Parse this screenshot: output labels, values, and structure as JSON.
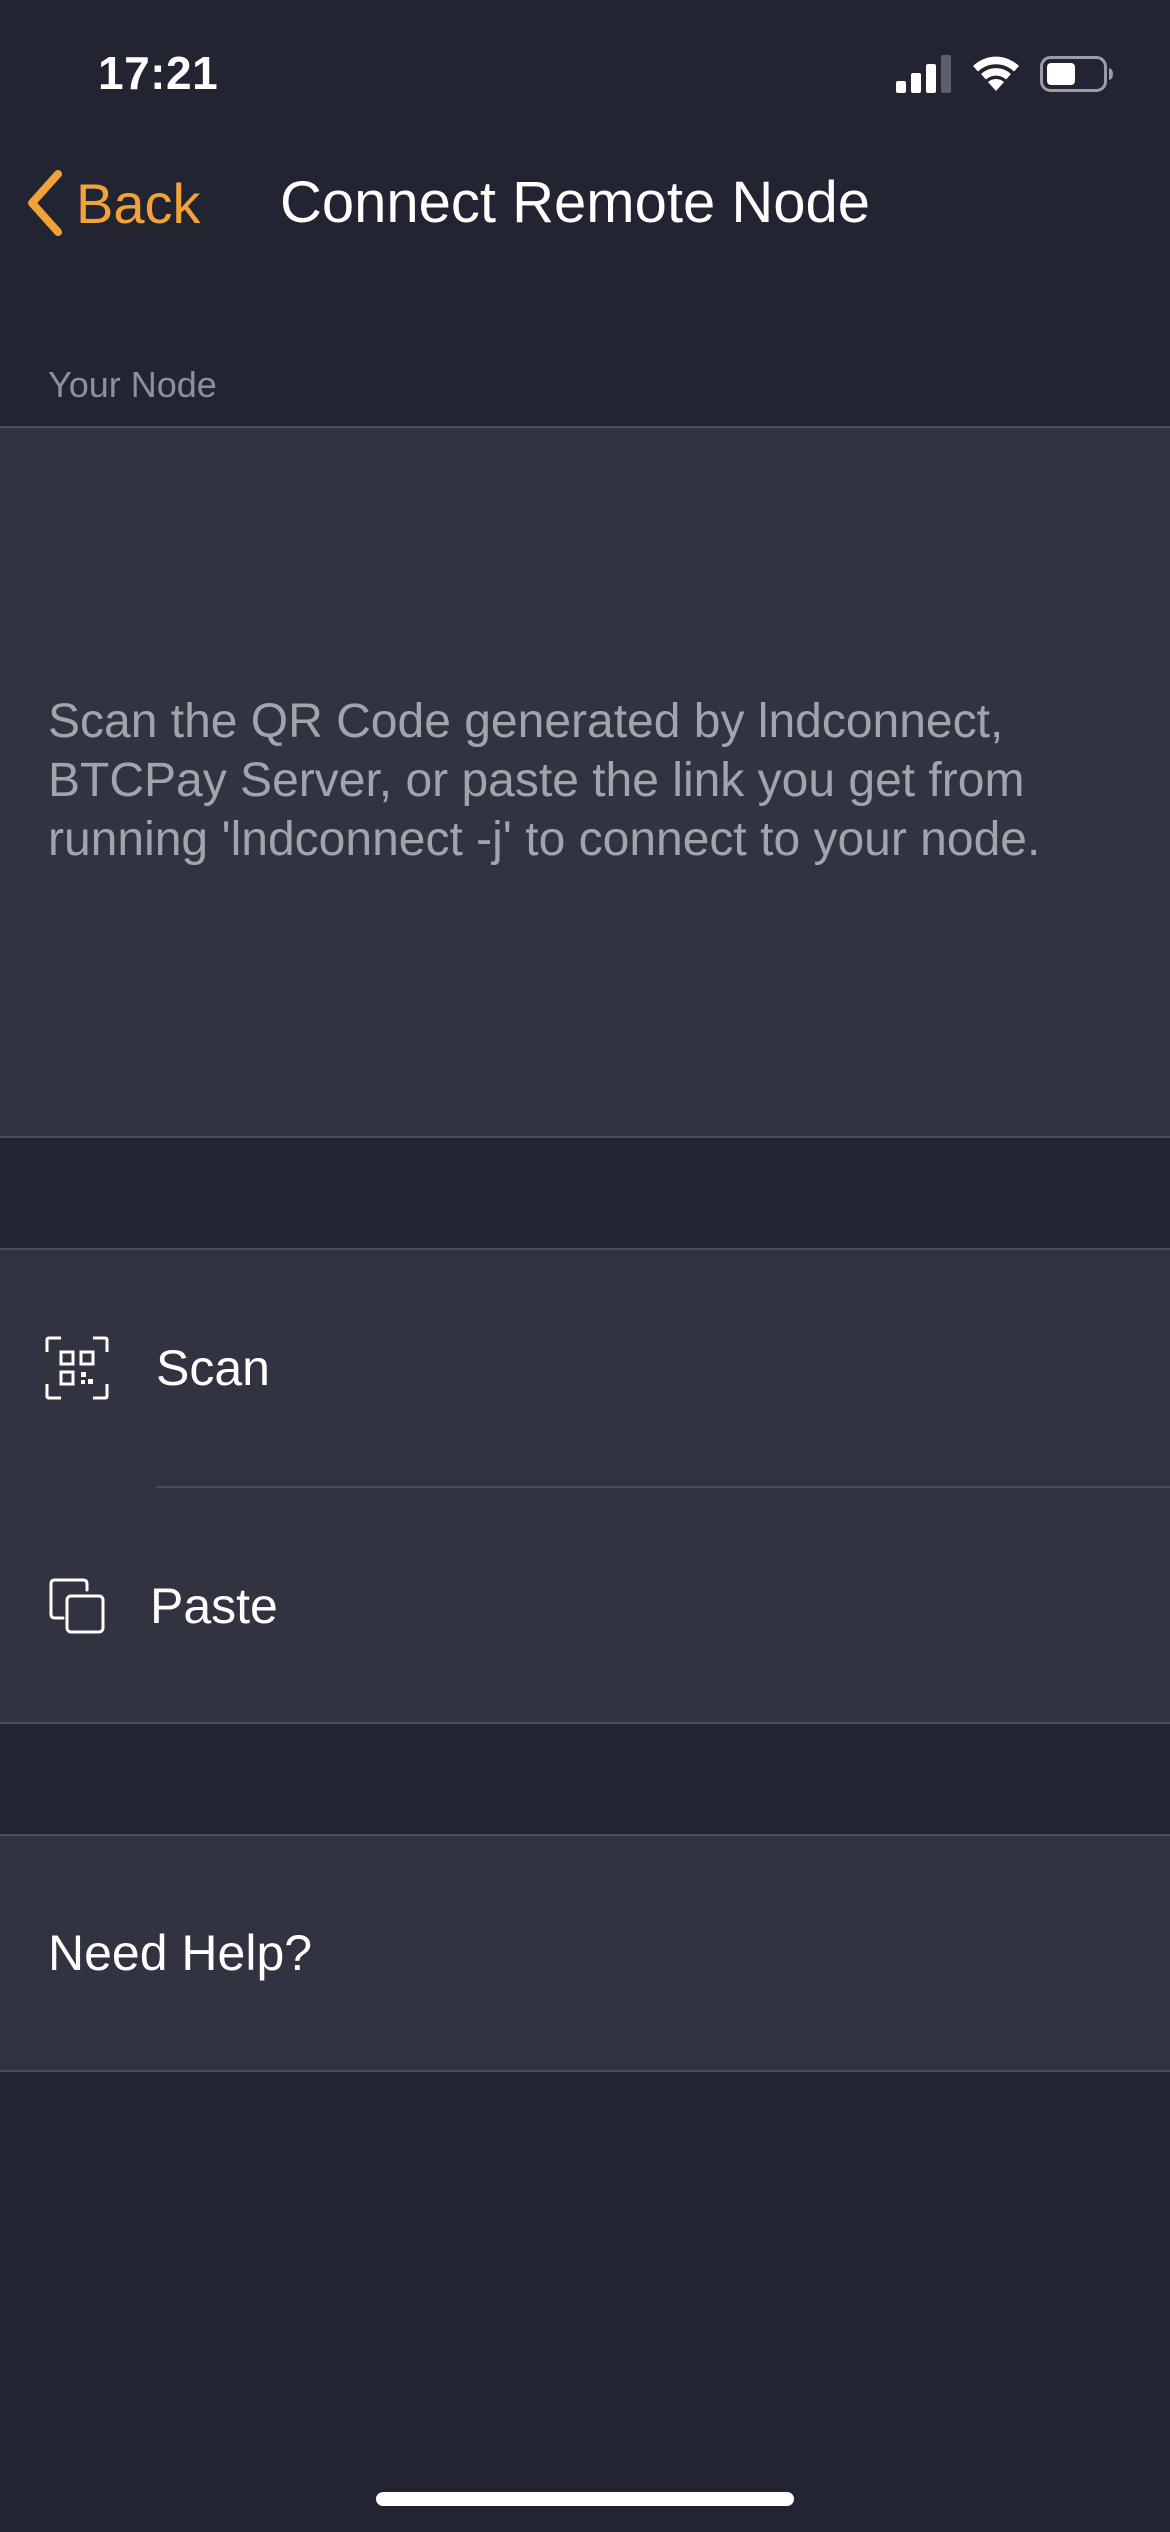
{
  "status_bar": {
    "time": "17:21",
    "icons": [
      "cellular-signal-icon",
      "wifi-icon",
      "battery-icon"
    ]
  },
  "nav": {
    "back_label": "Back",
    "title": "Connect Remote Node"
  },
  "section": {
    "header": "Your Node",
    "instructions": "Scan the QR Code generated by lndconnect, BTCPay Server, or paste the link you get from running 'lndconnect -j' to connect to your node."
  },
  "actions": [
    {
      "label": "Scan",
      "icon": "qr-scan-icon"
    },
    {
      "label": "Paste",
      "icon": "paste-icon"
    }
  ],
  "help": {
    "label": "Need Help?"
  },
  "colors": {
    "background": "#222432",
    "cell": "#313340",
    "accent": "#f3a23a"
  }
}
